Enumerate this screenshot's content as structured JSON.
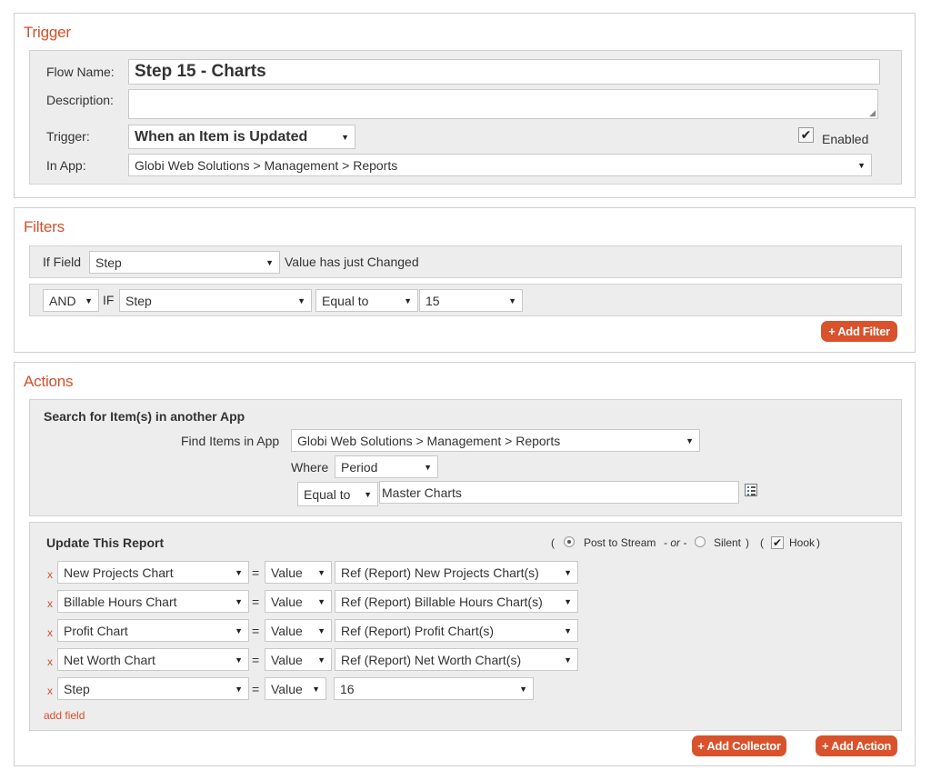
{
  "trigger": {
    "title": "Trigger",
    "flow_name_label": "Flow Name:",
    "flow_name_value": "Step 15 - Charts",
    "description_label": "Description:",
    "description_value": "",
    "trigger_label": "Trigger:",
    "trigger_value": "When an Item is Updated",
    "enabled_label": "Enabled",
    "enabled_checked": true,
    "in_app_label": "In App:",
    "in_app_value": "Globi Web Solutions > Management > Reports"
  },
  "filters": {
    "title": "Filters",
    "if_field_label": "If Field",
    "if_field_value": "Step",
    "changed_text": "Value has just Changed",
    "condition": {
      "conjunction": "AND",
      "if_label": "IF",
      "field": "Step",
      "operator": "Equal to",
      "value": "15"
    },
    "add_filter_label": "+ Add Filter"
  },
  "actions": {
    "title": "Actions",
    "search": {
      "title": "Search for Item(s) in another App",
      "find_label": "Find Items in App",
      "find_value": "Globi Web Solutions > Management > Reports",
      "where_label": "Where",
      "where_value": "Period",
      "operator": "Equal to",
      "match_value": "Master Charts",
      "picker_icon": "list-picker-icon"
    },
    "update": {
      "title": "Update This Report",
      "open_paren": "(",
      "post_label": "Post to Stream",
      "or_label": "- or -",
      "silent_label": "Silent",
      "close_paren": ")",
      "hook_open_paren": "(",
      "hook_label": "Hook",
      "hook_close_paren": ")",
      "post_selected": true,
      "hook_checked": true,
      "remove_label": "x",
      "equals": "=",
      "rows": [
        {
          "field": "New Projects Chart",
          "type": "Value",
          "value": "Ref (Report) New Projects Chart(s)"
        },
        {
          "field": "Billable Hours Chart",
          "type": "Value",
          "value": "Ref (Report) Billable Hours Chart(s)"
        },
        {
          "field": "Profit Chart",
          "type": "Value",
          "value": "Ref (Report) Profit Chart(s)"
        },
        {
          "field": "Net Worth Chart",
          "type": "Value",
          "value": "Ref (Report) Net Worth Chart(s)"
        },
        {
          "field": "Step",
          "type": "Value",
          "value": "16"
        }
      ],
      "add_field_label": "add field"
    },
    "add_collector_label": "+ Add Collector",
    "add_action_label": "+ Add Action"
  },
  "colors": {
    "accent": "#d4502a",
    "button": "#d9522b",
    "panel": "#ededed"
  }
}
